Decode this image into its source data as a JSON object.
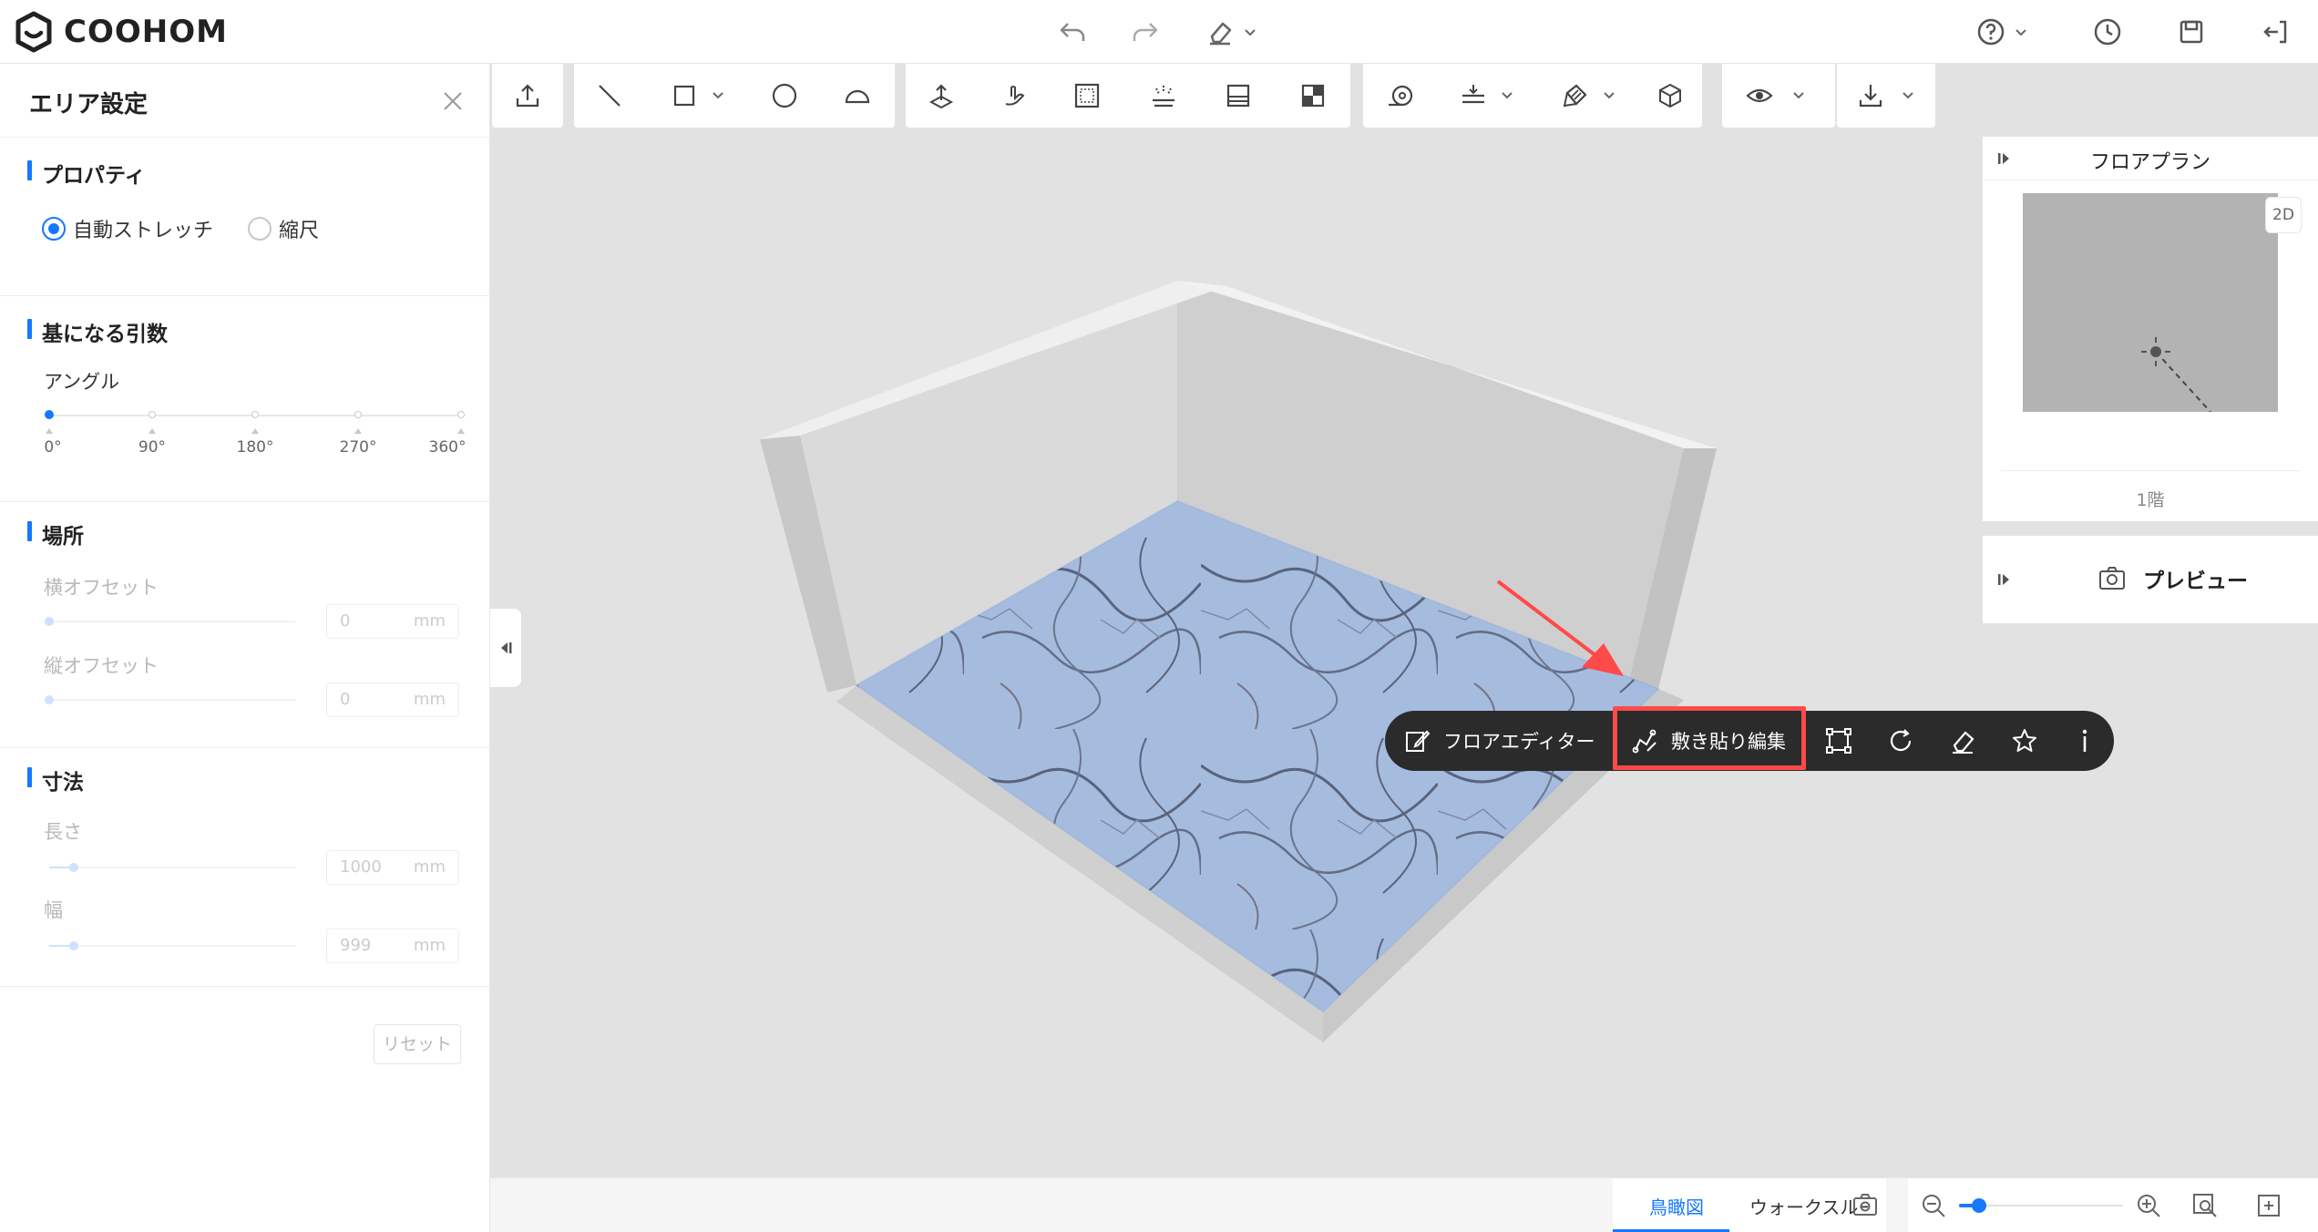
{
  "app": {
    "brand": "COOHOM"
  },
  "left_panel": {
    "title": "エリア設定",
    "properties": {
      "heading": "プロパティ",
      "options": [
        "自動ストレッチ",
        "縮尺"
      ],
      "selected": "自動ストレッチ"
    },
    "base_params": {
      "heading": "基になる引数",
      "angle_label": "アングル",
      "angle_ticks": [
        "0°",
        "90°",
        "180°",
        "270°",
        "360°"
      ],
      "angle_value": "0°"
    },
    "location": {
      "heading": "場所",
      "h_offset_label": "横オフセット",
      "h_offset_value": "0",
      "v_offset_label": "縦オフセット",
      "v_offset_value": "0",
      "unit": "mm"
    },
    "dimensions": {
      "heading": "寸法",
      "length_label": "長さ",
      "length_value": "1000",
      "width_label": "幅",
      "width_value": "999",
      "unit": "mm"
    },
    "reset_label": "リセット"
  },
  "context_bar": {
    "floor_editor": "フロアエディター",
    "tiling_edit": "敷き貼り編集"
  },
  "floor_plan": {
    "title": "フロアプラン",
    "mode": "2D",
    "floor": "1階"
  },
  "preview": {
    "label": "プレビュー"
  },
  "bottom": {
    "tabs": [
      "鳥瞰図",
      "ウォークスルー"
    ],
    "active_tab": "鳥瞰図",
    "zoom_level": 0.12
  },
  "colors": {
    "accent": "#1677ff",
    "highlight": "#ff4a4a",
    "dark_bar": "#2b2b2b"
  }
}
